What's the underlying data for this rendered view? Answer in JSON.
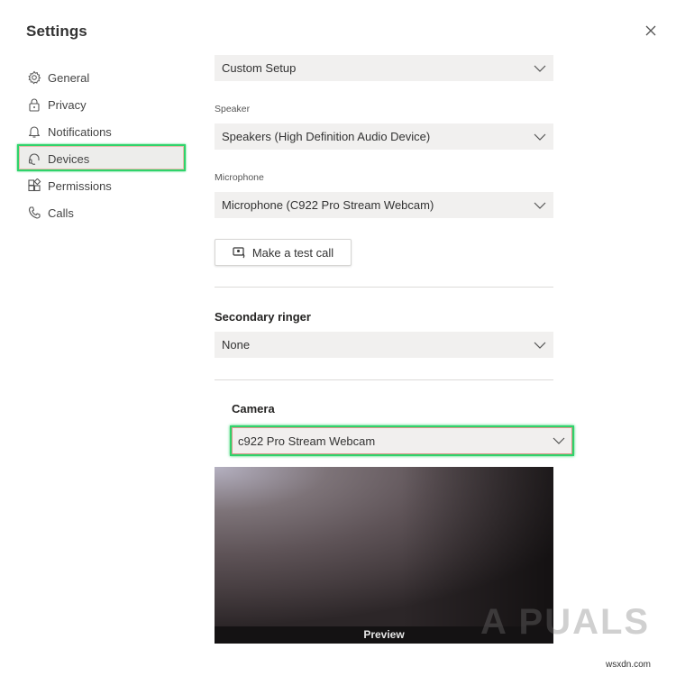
{
  "window": {
    "title": "Settings",
    "close_icon": "close-icon"
  },
  "sidebar": {
    "selected": "Devices",
    "items": [
      {
        "label": "General",
        "icon": "gear-icon"
      },
      {
        "label": "Privacy",
        "icon": "lock-icon"
      },
      {
        "label": "Notifications",
        "icon": "bell-icon"
      },
      {
        "label": "Devices",
        "icon": "headset-icon"
      },
      {
        "label": "Permissions",
        "icon": "grid-icon"
      },
      {
        "label": "Calls",
        "icon": "phone-icon"
      }
    ]
  },
  "main": {
    "audio_device": {
      "value": "Custom Setup"
    },
    "speaker": {
      "label": "Speaker",
      "value": "Speakers (High Definition Audio Device)"
    },
    "microphone": {
      "label": "Microphone",
      "value": "Microphone (C922 Pro Stream Webcam)"
    },
    "test_call_button": {
      "label": "Make a test call",
      "icon": "test-call-icon"
    },
    "secondary_ringer": {
      "heading": "Secondary ringer",
      "value": "None"
    },
    "camera": {
      "heading": "Camera",
      "value": "c922 Pro Stream Webcam"
    },
    "preview": {
      "label": "Preview"
    }
  },
  "highlight_color": "#2fd36b",
  "watermark": {
    "logo_text": "A  PUALS",
    "site": "wsxdn.com"
  }
}
